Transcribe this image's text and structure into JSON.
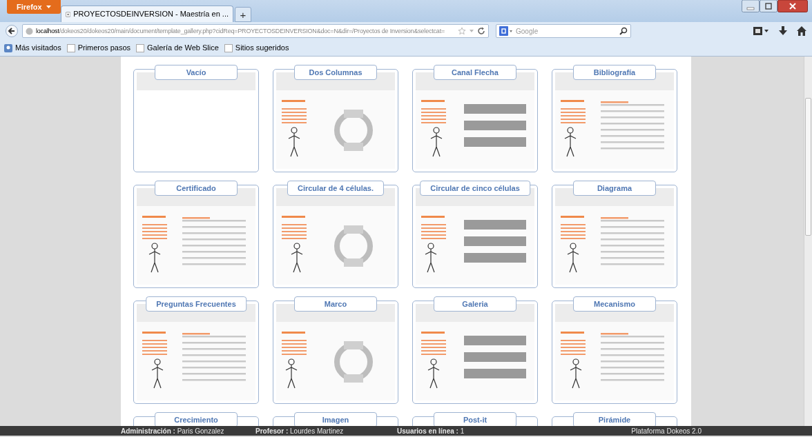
{
  "browser": {
    "menu_button": "Firefox",
    "tab_title": "PROYECTOSDEINVERSION - Maestría en ...",
    "new_tab": "+",
    "url_host": "localhost",
    "url_path": "/dokeos20/dokeos20/main/document/template_gallery.php?cidReq=PROYECTOSDEINVERSION&doc=N&dir=/Proyectos de Inversion&selectcat=",
    "search_placeholder": "Google"
  },
  "bookmarks": [
    {
      "label": "Más visitados",
      "kind": "special"
    },
    {
      "label": "Primeros pasos",
      "kind": "page"
    },
    {
      "label": "Galería de Web Slice",
      "kind": "page"
    },
    {
      "label": "Sitios sugeridos",
      "kind": "page"
    }
  ],
  "templates": [
    {
      "title": "Vacío",
      "kind": "blank"
    },
    {
      "title": "Dos Columnas",
      "kind": "slide"
    },
    {
      "title": "Canal Flecha",
      "kind": "slide"
    },
    {
      "title": "Bibliografía",
      "kind": "slide"
    },
    {
      "title": "Certificado",
      "kind": "slide"
    },
    {
      "title": "Circular de 4 células.",
      "kind": "slide"
    },
    {
      "title": "Circular de cinco células",
      "kind": "slide"
    },
    {
      "title": "Diagrama",
      "kind": "slide"
    },
    {
      "title": "Preguntas Frecuentes",
      "kind": "slide"
    },
    {
      "title": "Marco",
      "kind": "slide"
    },
    {
      "title": "Galeria",
      "kind": "slide"
    },
    {
      "title": "Mecanismo",
      "kind": "slide"
    },
    {
      "title": "Crecimiento",
      "kind": "cut"
    },
    {
      "title": "Imagen",
      "kind": "cut"
    },
    {
      "title": "Post-it",
      "kind": "cut"
    },
    {
      "title": "Pirámide",
      "kind": "cut"
    }
  ],
  "status_bar": {
    "items": [
      {
        "label": "Administración :",
        "value": "Paris Gonzalez"
      },
      {
        "label": "Profesor :",
        "value": "Lourdes Martinez"
      },
      {
        "label": "Usuarios en línea :",
        "value": "1"
      }
    ],
    "platform": "Plataforma Dokeos 2.0"
  }
}
